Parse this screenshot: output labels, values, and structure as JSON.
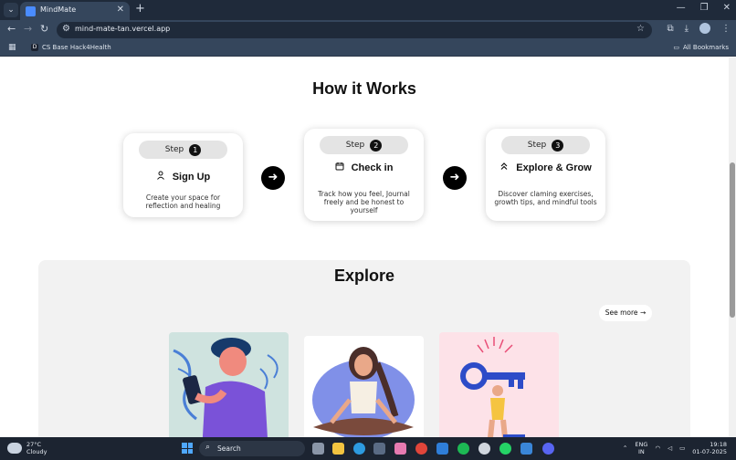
{
  "browser": {
    "tab_title": "MindMate",
    "url": "mind-mate-tan.vercel.app",
    "bookmark": "CS Base Hack4Health",
    "all_bookmarks": "All Bookmarks"
  },
  "how": {
    "title": "How it Works",
    "steps": [
      {
        "label": "Step",
        "num": "1",
        "title": "Sign Up",
        "icon": "user-icon",
        "desc": "Create your space for reflection and healing"
      },
      {
        "label": "Step",
        "num": "2",
        "title": "Check in",
        "icon": "calendar-icon",
        "desc": "Track how you feel, Journal freely and be honest to yourself"
      },
      {
        "label": "Step",
        "num": "3",
        "title": "Explore & Grow",
        "icon": "chevrons-up-icon",
        "desc": "Discover claming exercises, growth tips, and mindful tools"
      }
    ]
  },
  "explore": {
    "title": "Explore",
    "see_more": "See more"
  },
  "taskbar": {
    "temp": "27°C",
    "weather": "Cloudy",
    "search": "Search",
    "lang1": "ENG",
    "lang2": "IN",
    "time": "19:18",
    "date": "01-07-2025"
  },
  "colors": {
    "accent": "#000000",
    "panel": "#f2f2f2",
    "chrome": "#35465c"
  }
}
